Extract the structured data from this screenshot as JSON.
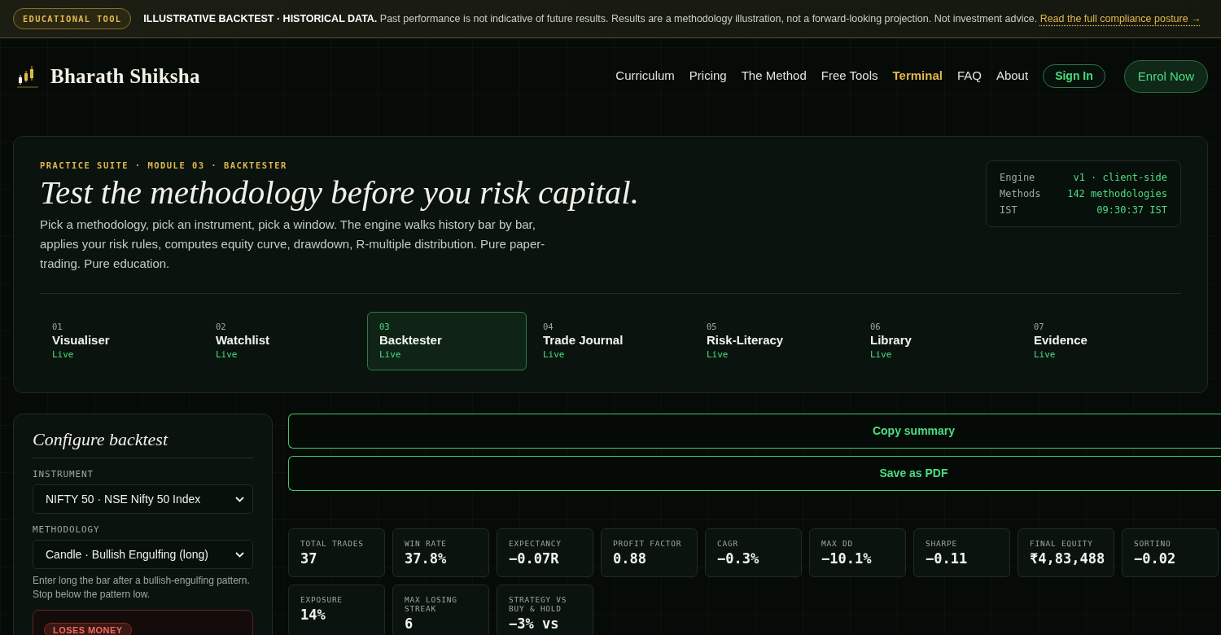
{
  "banner": {
    "badge": "EDUCATIONAL TOOL",
    "notice": "**ILLUSTRATIVE BACKTEST · HISTORICAL DATA.** Past performance is not indicative of future results. Results are a methodology illustration, not a forward-looking projection. Not investment advice.",
    "link": "Read the full compliance posture →"
  },
  "header": {
    "brand": "Bharath Shiksha",
    "nav": [
      {
        "label": "Curriculum",
        "selected": false
      },
      {
        "label": "Pricing",
        "selected": false
      },
      {
        "label": "The Method",
        "selected": false
      },
      {
        "label": "Free Tools",
        "selected": false
      },
      {
        "label": "Terminal",
        "selected": true
      },
      {
        "label": "FAQ",
        "selected": false
      },
      {
        "label": "About",
        "selected": false
      }
    ],
    "sign_in": "Sign In",
    "enrol": "Enrol Now"
  },
  "hero": {
    "kicker": "PRACTICE SUITE · MODULE 03 · BACKTESTER",
    "title": "Test the methodology before you risk capital.",
    "description": "Pick a methodology, pick an instrument, pick a window. The engine walks history bar by bar, applies your risk rules, computes equity curve, drawdown, R-multiple distribution. Pure paper-trading. Pure education.",
    "engine_info": [
      {
        "label": "Engine",
        "value": "v1 · client-side"
      },
      {
        "label": "Methods",
        "value": "142 methodologies"
      },
      {
        "label": "IST",
        "value": "09:30:37 IST"
      }
    ],
    "modules": [
      {
        "number": "01",
        "name": "Visualiser",
        "status": "Live",
        "selected": false
      },
      {
        "number": "02",
        "name": "Watchlist",
        "status": "Live",
        "selected": false
      },
      {
        "number": "03",
        "name": "Backtester",
        "status": "Live",
        "selected": true
      },
      {
        "number": "04",
        "name": "Trade Journal",
        "status": "Live",
        "selected": false
      },
      {
        "number": "05",
        "name": "Risk-Literacy",
        "status": "Live",
        "selected": false
      },
      {
        "number": "06",
        "name": "Library",
        "status": "Live",
        "selected": false
      },
      {
        "number": "07",
        "name": "Evidence",
        "status": "Live",
        "selected": false
      }
    ]
  },
  "config": {
    "title": "Configure backtest",
    "fields": [
      {
        "label": "INSTRUMENT",
        "value": "NIFTY 50 · NSE Nifty 50 Index"
      },
      {
        "label": "METHODOLOGY",
        "value": "Candle · Bullish Engulfing (long)",
        "hint": "Enter long the bar after a bullish-engulfing pattern. Stop below the pattern low."
      }
    ],
    "verdict": "LOSES MONEY"
  },
  "actions": [
    "Copy summary",
    "Save as PDF"
  ],
  "stats": [
    {
      "label": "TOTAL TRADES",
      "value": "37"
    },
    {
      "label": "WIN RATE",
      "value": "37.8%"
    },
    {
      "label": "EXPECTANCY",
      "value": "−0.07R"
    },
    {
      "label": "PROFIT FACTOR",
      "value": "0.88"
    },
    {
      "label": "CAGR",
      "value": "−0.3%"
    },
    {
      "label": "MAX DD",
      "value": "−10.1%"
    },
    {
      "label": "SHARPE",
      "value": "−0.11"
    },
    {
      "label": "FINAL EQUITY",
      "value": "₹4,83,488"
    },
    {
      "label": "SORTINO",
      "value": "−0.02"
    },
    {
      "label": "EXPOSURE",
      "value": "14%"
    },
    {
      "label": "MAX LOSING STREAK",
      "value": "6"
    },
    {
      "label": "STRATEGY VS BUY & HOLD",
      "value": "−3% vs"
    }
  ]
}
